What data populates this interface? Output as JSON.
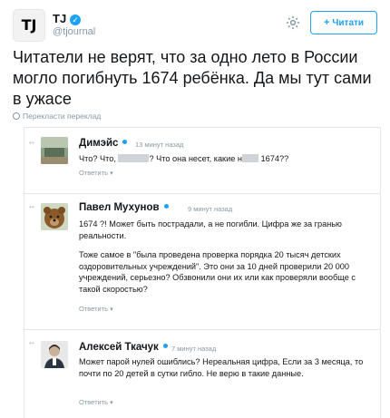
{
  "account": {
    "avatar_text": "TJ",
    "name": "TJ",
    "verified_mark": "✓",
    "handle": "@tjournal",
    "follow_label": "Читати",
    "follow_icon": "+",
    "gear_icon": "gear-icon"
  },
  "tweet": {
    "text": "Читатели не верят, что за одно лето в России могло погибнуть 1674 ребёнка. Да мы тут сами в ужасе",
    "translate_label": "Перекласти переклад"
  },
  "comments": [
    {
      "name": "Димэйс",
      "time": "13 минут назад",
      "body_before": "Что? Что,",
      "body_middle": "? Что она несет, какие н",
      "body_after": "1674??",
      "reply": "Ответить"
    },
    {
      "name": "Павел Мухунов",
      "time": "9 минут назад",
      "paragraph1": "1674 ?! Может быть пострадали, а не погибли. Цифра же за гранью реальности.",
      "paragraph2": "Тоже самое в \"была проведена проверка порядка 20 тысяч детских оздоровительных учреждений\". Это они за 10 дней проверили 20 000 учреждений, серьезно? Обзвонили они их или как проверяли вообще с такой скоростью?",
      "reply": "Ответить"
    },
    {
      "name": "Алексей Ткачук",
      "time": "7 минут назад",
      "body": "Может парой нулей ошиблись? Нереальная цифра, Если за 3 месяца, то почти по 20 детей в сутки гибло. Не верю в такие данные.",
      "reply": "Ответить"
    }
  ],
  "colors": {
    "accent": "#1da1f2",
    "muted": "#8899a6",
    "border": "#e1e8ed"
  }
}
